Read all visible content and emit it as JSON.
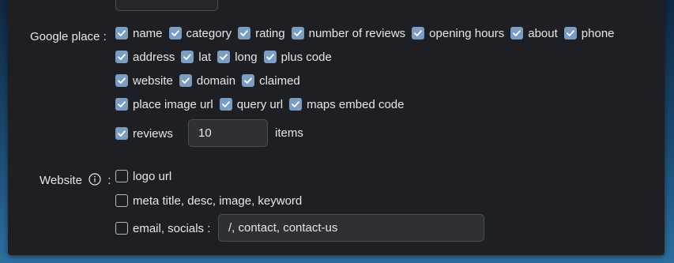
{
  "google_place": {
    "label": "Google place :",
    "options_row1": [
      {
        "label": "name",
        "checked": true
      },
      {
        "label": "category",
        "checked": true
      },
      {
        "label": "rating",
        "checked": true
      },
      {
        "label": "number of reviews",
        "checked": true
      },
      {
        "label": "opening hours",
        "checked": true
      },
      {
        "label": "about",
        "checked": true
      },
      {
        "label": "phone",
        "checked": true
      }
    ],
    "options_row2": [
      {
        "label": "address",
        "checked": true
      },
      {
        "label": "lat",
        "checked": true
      },
      {
        "label": "long",
        "checked": true
      },
      {
        "label": "plus code",
        "checked": true
      }
    ],
    "options_row3": [
      {
        "label": "website",
        "checked": true
      },
      {
        "label": "domain",
        "checked": true
      },
      {
        "label": "claimed",
        "checked": true
      }
    ],
    "options_row4": [
      {
        "label": "place image url",
        "checked": true
      },
      {
        "label": "query url",
        "checked": true
      },
      {
        "label": "maps embed code",
        "checked": true
      }
    ],
    "reviews": {
      "label": "reviews",
      "checked": true,
      "count": "10",
      "unit": "items"
    }
  },
  "website": {
    "label": "Website",
    "colon": ":",
    "info_icon": "info-circle-icon",
    "logo_url": {
      "label": "logo url",
      "checked": false
    },
    "meta": {
      "label": "meta title, desc, image, keyword",
      "checked": false
    },
    "email": {
      "label": "email, socials :",
      "checked": false,
      "value": "/, contact, contact-us"
    }
  },
  "colors": {
    "checkbox_checked": "#7b9dc1",
    "panel_bg": "#1d1f24",
    "input_bg": "#2e3036"
  }
}
